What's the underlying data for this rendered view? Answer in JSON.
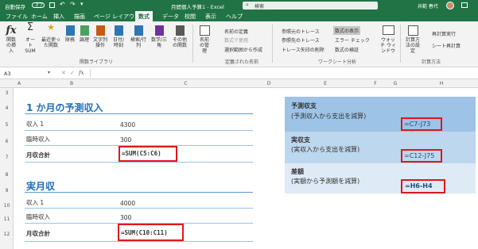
{
  "app": {
    "autosave": "自動保存",
    "title": "月間個人予算1 - Excel",
    "search": "検索",
    "user": "井範 春代",
    "autosave_state": "オフ"
  },
  "tabs": [
    "ファイル",
    "ホーム",
    "挿入",
    "描画",
    "ページ レイアウト",
    "数式",
    "データ",
    "校閲",
    "表示",
    "ヘルプ"
  ],
  "ribbon": {
    "insert_function": "関数の挿入",
    "autosum": "オート SUM",
    "recent": "最近使った関数",
    "financial": "財務",
    "logical": "論理",
    "text": "文字列操作",
    "datetime": "日付/時刻",
    "lookup": "検索/行列",
    "math": "数学/三角",
    "more": "その他の関数",
    "group_library": "関数ライブラリ",
    "name_manager": "名前の管理",
    "define_name": "名前の定義",
    "use_in_formula": "数式で使用",
    "create_from_sel": "選択範囲から作成",
    "group_names": "定義された名前",
    "trace_prec": "参照元のトレース",
    "trace_dep": "参照先のトレース",
    "remove_arrows": "トレース矢印の削除",
    "show_formulas": "数式の表示",
    "error_check": "エラー チェック",
    "evaluate": "数式の検証",
    "watch": "ウォッチ ウィンドウ",
    "group_audit": "ワークシート分析",
    "calc_options": "計算方法の設定",
    "calc_now": "再計算実行",
    "calc_sheet": "シート再計算",
    "group_calc": "計算方法"
  },
  "formula_bar": {
    "cell_ref": "A3",
    "fx": "fx"
  },
  "columns": [
    "A",
    "B",
    "C",
    "D",
    "E",
    "F",
    "G",
    "H"
  ],
  "rows": [
    "3",
    "4",
    "5",
    "6",
    "7",
    "8",
    "9",
    "10",
    "11",
    "12"
  ],
  "sheet": {
    "h1": "1 か月の予測収入",
    "income1_label": "収入 1",
    "income1_val": "4300",
    "extra_label": "臨時収入",
    "extra_val": "300",
    "total_label": "月収合計",
    "total_formula": "=SUM(C5:C6)",
    "h2": "実月収",
    "a_income1_label": "収入 1",
    "a_income1_val": "4000",
    "a_extra_label": "臨時収入",
    "a_extra_val": "300",
    "a_total_label": "月収合計",
    "a_total_formula": "=SUM(C10:C11)"
  },
  "summary": [
    {
      "title": "予測収支",
      "desc": "(予測収入から支出を減算)",
      "formula": "=C7-J73"
    },
    {
      "title": "実収支",
      "desc": "(実収入から支出を減算)",
      "formula": "=C12-J75"
    },
    {
      "title": "差額",
      "desc": "(実額から予測額を減算)",
      "formula": "=H6-H4"
    }
  ],
  "colors": {
    "excel_green": "#217346",
    "accent_blue": "#1f6fb7",
    "box1": "#9dc3e6",
    "box2": "#bdd7ee",
    "box3": "#deebf7",
    "red": "#e0161c"
  }
}
